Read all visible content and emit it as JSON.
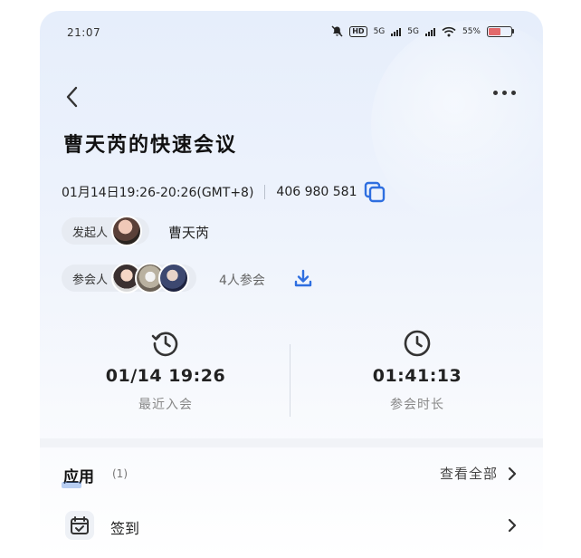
{
  "status_bar": {
    "time": "21:07",
    "battery": "55%",
    "signal_a": "5G",
    "signal_b": "5G",
    "hd": "HD"
  },
  "meeting": {
    "title": "曹天芮的快速会议",
    "time_range": "01月14日19:26-20:26(GMT+8)",
    "meeting_id": "406 980 581"
  },
  "initiator": {
    "label": "发起人",
    "name": "曹天芮"
  },
  "participants": {
    "label": "参会人",
    "count_text": "4人参会"
  },
  "stats": {
    "last_join": {
      "value": "01/14 19:26",
      "label": "最近入会"
    },
    "duration": {
      "value": "01:41:13",
      "label": "参会时长"
    }
  },
  "apps": {
    "title": "应用",
    "count": "(1)",
    "view_all": "查看全部"
  },
  "signin": {
    "label": "签到"
  },
  "colors": {
    "accent": "#2f6fe0",
    "battery": "#e2696b",
    "chip_bg": "#e7ebf2"
  },
  "icons": [
    "back-arrow-icon",
    "more-icon",
    "copy-icon",
    "download-icon",
    "history-clock-icon",
    "clock-icon",
    "chevron-right-icon",
    "calendar-check-icon"
  ]
}
